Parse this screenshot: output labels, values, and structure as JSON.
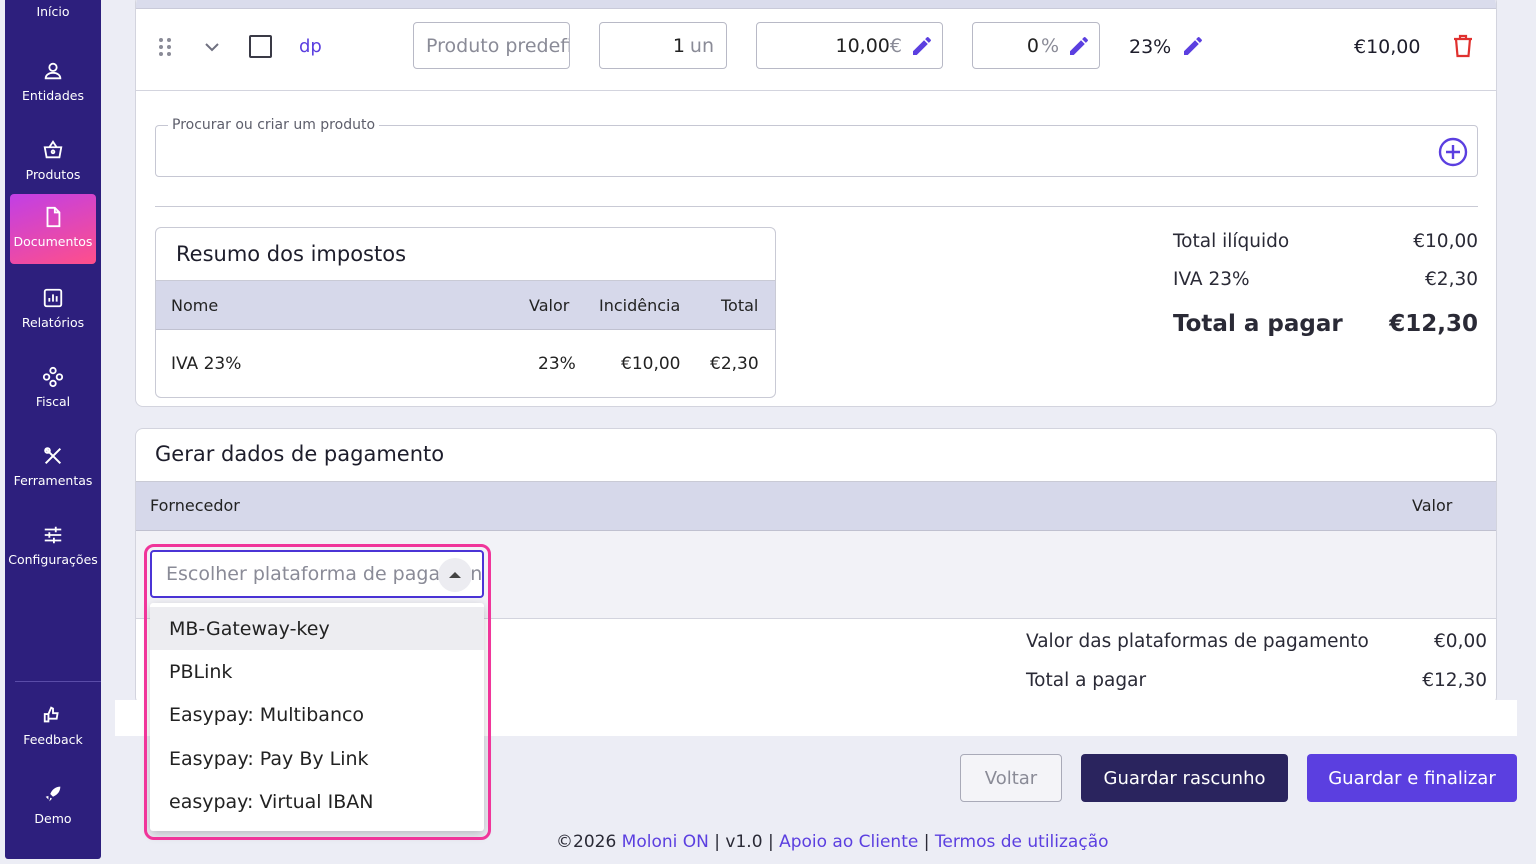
{
  "sidebar": {
    "inicio": "Início",
    "items": [
      {
        "label": "Entidades",
        "icon": "user-icon"
      },
      {
        "label": "Produtos",
        "icon": "basket-icon"
      },
      {
        "label": "Documentos",
        "icon": "document-icon"
      },
      {
        "label": "Relatórios",
        "icon": "chart-icon"
      },
      {
        "label": "Fiscal",
        "icon": "fiscal-icon"
      },
      {
        "label": "Ferramentas",
        "icon": "tools-icon"
      },
      {
        "label": "Configurações",
        "icon": "sliders-icon"
      },
      {
        "label": "Feedback",
        "icon": "thumbs-icon"
      },
      {
        "label": "Demo",
        "icon": "rocket-icon"
      }
    ],
    "active_color": "#c13fe6"
  },
  "line": {
    "ref": "dp",
    "product_placeholder": "Produto predefinido",
    "qty_value": "1",
    "qty_unit": "un",
    "price_value": "10,00",
    "price_unit": "€",
    "discount_value": "0",
    "discount_unit": "%",
    "tax": "23%",
    "total": "€10,00"
  },
  "search": {
    "legend": "Procurar ou criar um produto"
  },
  "tax_summary": {
    "title": "Resumo dos impostos",
    "headers": [
      "Nome",
      "Valor",
      "Incidência",
      "Total"
    ],
    "row": {
      "name": "IVA 23%",
      "value": "23%",
      "incidence": "€10,00",
      "total": "€2,30"
    }
  },
  "totals": {
    "net_label": "Total ilíquido",
    "net_value": "€10,00",
    "vat_label": "IVA 23%",
    "vat_value": "€2,30",
    "pay_label": "Total a pagar",
    "pay_value": "€12,30"
  },
  "payment": {
    "title": "Gerar dados de pagamento",
    "col_supplier": "Fornecedor",
    "col_value": "Valor",
    "select_placeholder": "Escolher plataforma de pagamento",
    "options": [
      "MB-Gateway-key",
      "PBLink",
      "Easypay: Multibanco",
      "Easypay: Pay By Link",
      "easypay: Virtual IBAN"
    ],
    "platforms_label": "Valor das plataformas de pagamento",
    "platforms_value": "€0,00",
    "total_label": "Total a pagar",
    "total_value": "€12,30"
  },
  "buttons": {
    "back": "Voltar",
    "draft": "Guardar rascunho",
    "finalize": "Guardar e finalizar"
  },
  "footer": {
    "copyright": "©2026",
    "brand": "Moloni ON",
    "version": "v1.0",
    "support": "Apoio ao Cliente",
    "terms": "Termos de utilização",
    "sep": "|"
  },
  "colors": {
    "accent": "#5b3fe0",
    "sidebar": "#2d1f7d",
    "highlight": "#f0359a",
    "delete": "#e0312f"
  }
}
